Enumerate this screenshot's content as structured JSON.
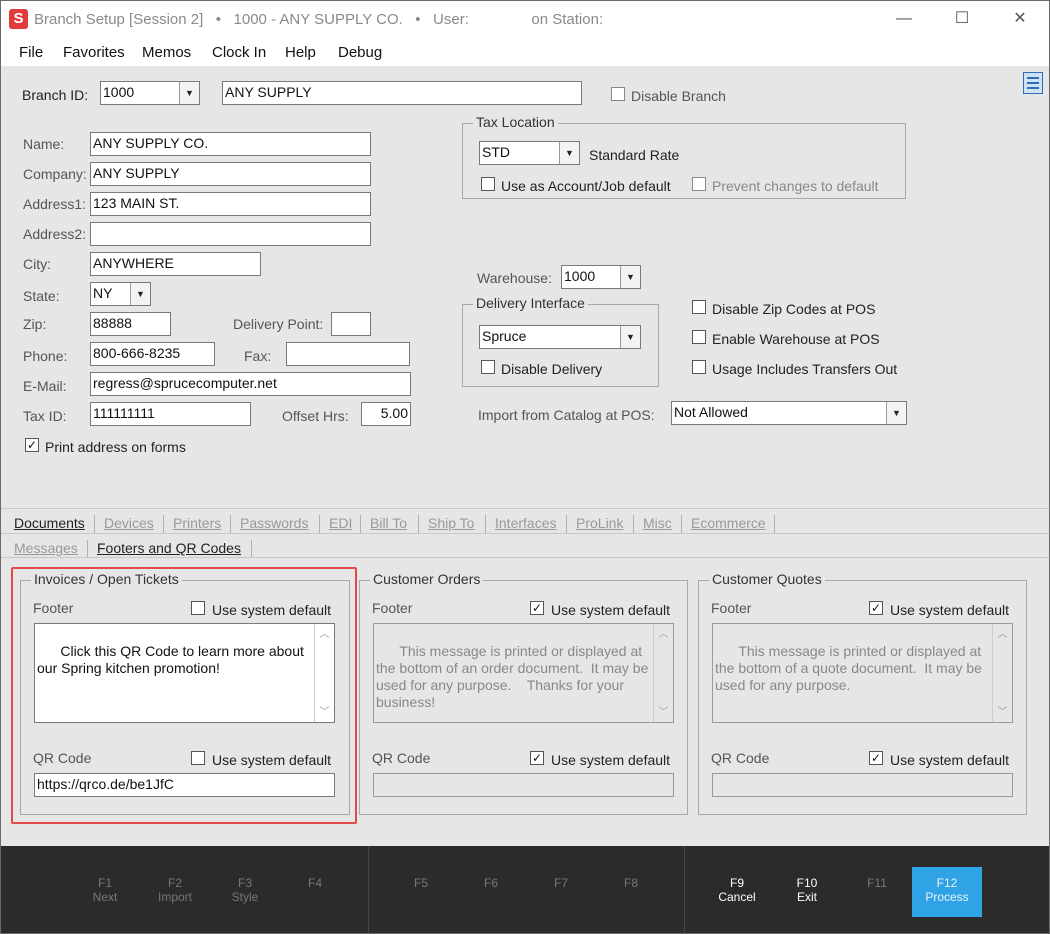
{
  "window": {
    "title": "Branch Setup [Session 2]   •   1000 - ANY SUPPLY CO.   •   User:               on Station:",
    "minimize": "—",
    "maximize": "☐",
    "close": "✕"
  },
  "menu": [
    "File",
    "Favorites",
    "Memos",
    "Clock In",
    "Help",
    "Debug"
  ],
  "branch": {
    "id_label": "Branch ID:",
    "id_value": "1000",
    "name_value": "ANY SUPPLY",
    "disable_branch": "Disable Branch"
  },
  "address": {
    "name_label": "Name:",
    "name_value": "ANY SUPPLY CO.",
    "company_label": "Company:",
    "company_value": "ANY SUPPLY",
    "address1_label": "Address1:",
    "address1_value": "123 MAIN ST.",
    "address2_label": "Address2:",
    "address2_value": "",
    "city_label": "City:",
    "city_value": "ANYWHERE",
    "state_label": "State:",
    "state_value": "NY",
    "zip_label": "Zip:",
    "zip_value": "88888",
    "delivery_point_label": "Delivery Point:",
    "delivery_point_value": "",
    "phone_label": "Phone:",
    "phone_value": "800-666-8235",
    "fax_label": "Fax:",
    "fax_value": "",
    "email_label": "E-Mail:",
    "email_value": "regress@sprucecomputer.net",
    "taxid_label": "Tax ID:",
    "taxid_value": "111111111",
    "offset_label": "Offset Hrs:",
    "offset_value": "5.00",
    "print_address": "Print address on forms",
    "print_address_checked": true
  },
  "tax_location": {
    "title": "Tax Location",
    "value": "STD",
    "rate": "Standard Rate",
    "use_default": "Use as Account/Job default",
    "prevent_changes": "Prevent changes to default"
  },
  "warehouse": {
    "label": "Warehouse:",
    "value": "1000"
  },
  "delivery": {
    "title": "Delivery Interface",
    "value": "Spruce",
    "disable": "Disable Delivery"
  },
  "options": {
    "disable_zip": "Disable Zip Codes at POS",
    "enable_warehouse": "Enable Warehouse at POS",
    "usage_transfers": "Usage Includes Transfers Out"
  },
  "catalog": {
    "label": "Import from Catalog at POS:",
    "value": "Not Allowed"
  },
  "tabs": [
    "Documents",
    "Devices",
    "Printers",
    "Passwords",
    "EDI",
    "Bill To",
    "Ship To",
    "Interfaces",
    "ProLink",
    "Misc",
    "Ecommerce"
  ],
  "subtabs": [
    "Messages",
    "Footers and QR Codes"
  ],
  "panels": [
    {
      "title": "Invoices / Open Tickets",
      "footer_label": "Footer",
      "footer_default_label": "Use system default",
      "footer_default_checked": false,
      "footer_text": "Click this QR Code to learn more about our Spring kitchen promotion!",
      "qr_label": "QR Code",
      "qr_default_label": "Use system default",
      "qr_default_checked": false,
      "qr_value": "https://qrco.de/be1JfC"
    },
    {
      "title": "Customer Orders",
      "footer_label": "Footer",
      "footer_default_label": "Use system default",
      "footer_default_checked": true,
      "footer_text": "This message is printed or displayed at the bottom of an order document.  It may be used for any purpose.    Thanks for your business!",
      "qr_label": "QR Code",
      "qr_default_label": "Use system default",
      "qr_default_checked": true,
      "qr_value": ""
    },
    {
      "title": "Customer Quotes",
      "footer_label": "Footer",
      "footer_default_label": "Use system default",
      "footer_default_checked": true,
      "footer_text": "This message is printed or displayed at the bottom of a quote document.  It may be used for any purpose.",
      "qr_label": "QR Code",
      "qr_default_label": "Use system default",
      "qr_default_checked": true,
      "qr_value": ""
    }
  ],
  "fkeys": [
    {
      "key": "F1",
      "label": "Next",
      "active": false
    },
    {
      "key": "F2",
      "label": "Import",
      "active": false
    },
    {
      "key": "F3",
      "label": "Style",
      "active": false
    },
    {
      "key": "F4",
      "label": "",
      "active": false
    },
    {
      "key": "F5",
      "label": "",
      "active": false
    },
    {
      "key": "F6",
      "label": "",
      "active": false
    },
    {
      "key": "F7",
      "label": "",
      "active": false
    },
    {
      "key": "F8",
      "label": "",
      "active": false
    },
    {
      "key": "F9",
      "label": "Cancel",
      "active": true
    },
    {
      "key": "F10",
      "label": "Exit",
      "active": true
    },
    {
      "key": "F11",
      "label": "",
      "active": false
    },
    {
      "key": "F12",
      "label": "Process",
      "active": true
    }
  ],
  "colors": {
    "accent": "#2fa3e6",
    "highlight": "#e04a4a",
    "brand": "#e03a3a"
  }
}
